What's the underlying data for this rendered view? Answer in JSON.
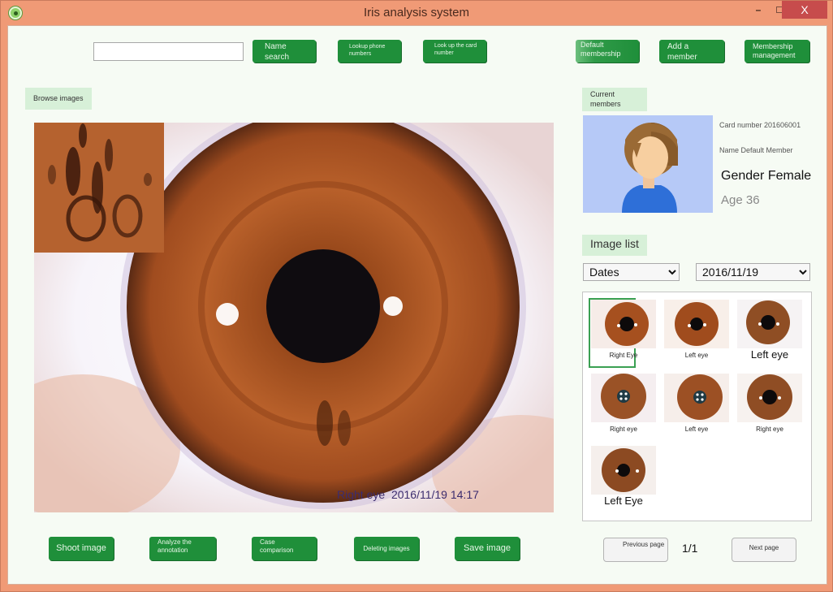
{
  "window": {
    "title": "Iris analysis system",
    "controls": {
      "minimize": "–",
      "maximize": "□",
      "close": "X"
    }
  },
  "toolbar": {
    "search": {
      "value": "",
      "placeholder": ""
    },
    "buttons": [
      {
        "id": "name-search",
        "label": "Name search"
      },
      {
        "id": "lookup-phone",
        "label": "Lookup phone numbers"
      },
      {
        "id": "lookup-card",
        "label": "Look up the card number"
      },
      {
        "id": "default-membership",
        "label": "Default membership"
      },
      {
        "id": "add-member",
        "label": "Add a member"
      },
      {
        "id": "membership-management",
        "label": "Membership management"
      }
    ]
  },
  "browse": {
    "label": "Browse images",
    "caption_eye": "Right eye",
    "caption_datetime": "2016/11/19 14:17"
  },
  "member": {
    "section_label": "Current members",
    "card_number": "Card number 201606001",
    "name": "Name Default Member",
    "gender": "Gender Female",
    "age": "Age 36"
  },
  "image_list": {
    "label": "Image list",
    "filter_type": {
      "selected": "Dates"
    },
    "filter_date": {
      "selected": "2016/11/19"
    },
    "items": [
      {
        "caption": "Right Eye",
        "selected": true
      },
      {
        "caption": "Left eye",
        "selected": false
      },
      {
        "caption": "Left eye",
        "selected": false
      },
      {
        "caption": "Right eye",
        "selected": false
      },
      {
        "caption": "Left eye",
        "selected": false
      },
      {
        "caption": "Right eye",
        "selected": false
      },
      {
        "caption": "Left Eye",
        "selected": false
      }
    ]
  },
  "actions": {
    "shoot": "Shoot image",
    "analyze": "Analyze the annotation",
    "compare": "Case comparison",
    "delete": "Deleting images",
    "save": "Save image"
  },
  "pagination": {
    "previous": "Previous page",
    "indicator": "1/1",
    "next": "Next page"
  },
  "colors": {
    "accent": "#1f8f3a",
    "window_frame": "#f09a76",
    "close_button": "#c74c4c",
    "background": "#f6fbf4"
  }
}
